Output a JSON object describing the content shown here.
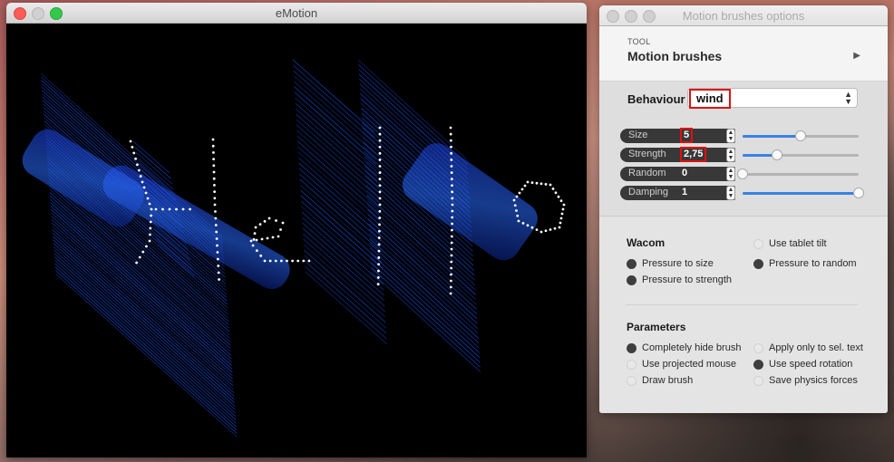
{
  "main_window": {
    "title": "eMotion"
  },
  "options_window": {
    "title": "Motion brushes options",
    "tool": {
      "label": "TOOL",
      "name": "Motion brushes"
    },
    "behaviour": {
      "label": "Behaviour",
      "value": "wind"
    },
    "params": [
      {
        "name": "Size",
        "value": "5",
        "slider": 0.5
      },
      {
        "name": "Strength",
        "value": "2,75",
        "slider": 0.3
      },
      {
        "name": "Random",
        "value": "0",
        "slider": 0.0
      },
      {
        "name": "Damping",
        "value": "1",
        "slider": 1.0
      }
    ],
    "wacom": {
      "title": "Wacom",
      "options": [
        {
          "label": "Use tablet tilt",
          "checked": false
        },
        {
          "label": "Pressure to size",
          "checked": true
        },
        {
          "label": "Pressure to random",
          "checked": true
        },
        {
          "label": "Pressure to strength",
          "checked": true
        }
      ]
    },
    "parameters": {
      "title": "Parameters",
      "options": [
        {
          "label": "Completely hide brush",
          "checked": true
        },
        {
          "label": "Apply only to sel. text",
          "checked": false
        },
        {
          "label": "Use projected mouse",
          "checked": false
        },
        {
          "label": "Use speed rotation",
          "checked": true
        },
        {
          "label": "Draw brush",
          "checked": false
        },
        {
          "label": "Save physics forces",
          "checked": false
        }
      ]
    }
  }
}
